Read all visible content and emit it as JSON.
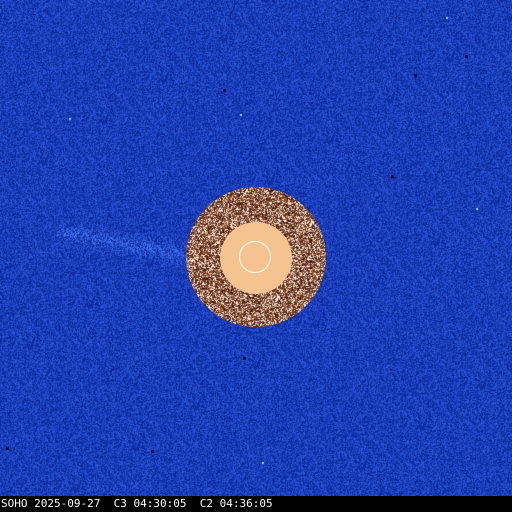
{
  "image": {
    "description_colors": {
      "background": "#1a3fbf",
      "occulter_ring": "#7a4a2e",
      "occulter_center": "#f5c38f",
      "sun_outline": "#ffffff",
      "footer_bg": "#000000",
      "footer_text": "#ffffff"
    }
  },
  "footer": {
    "observatory": "SOHO",
    "date": "2025-09-27",
    "c3_label": "C3",
    "c3_time": "04:30:05",
    "c2_label": "C2",
    "c2_time": "04:36:05"
  }
}
